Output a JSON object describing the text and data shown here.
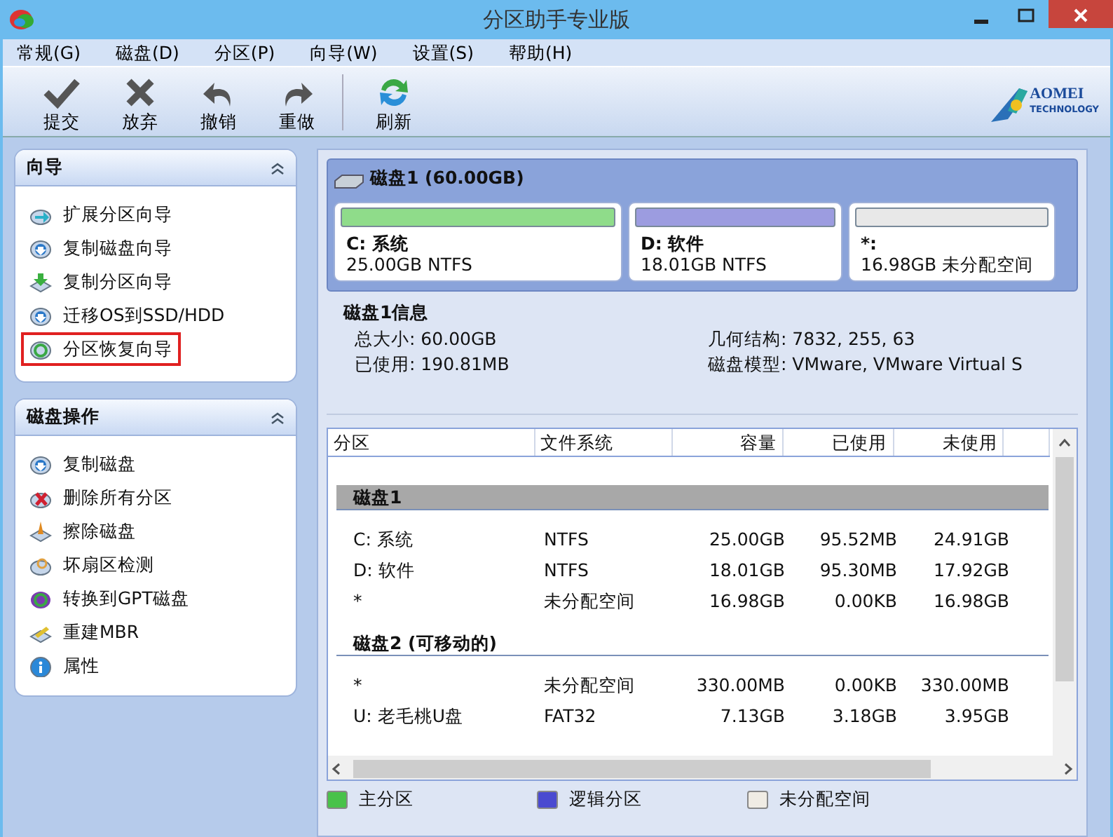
{
  "window": {
    "title": "分区助手专业版"
  },
  "menu": [
    "常规(G)",
    "磁盘(D)",
    "分区(P)",
    "向导(W)",
    "设置(S)",
    "帮助(H)"
  ],
  "toolbar": [
    {
      "label": "提交",
      "kind": "check"
    },
    {
      "label": "放弃",
      "kind": "cross"
    },
    {
      "label": "撤销",
      "kind": "undo"
    },
    {
      "label": "重做",
      "kind": "redo"
    },
    {
      "label": "刷新",
      "kind": "refresh"
    }
  ],
  "logo": {
    "name": "AOMEI",
    "tagline": "TECHNOLOGY"
  },
  "sidebar": [
    {
      "title": "向导",
      "items": [
        {
          "label": "扩展分区向导",
          "kind": "arrow",
          "highlighted": false
        },
        {
          "label": "复制磁盘向导",
          "kind": "down",
          "highlighted": false
        },
        {
          "label": "复制分区向导",
          "kind": "green",
          "highlighted": false
        },
        {
          "label": "迁移OS到SSD/HDD",
          "kind": "down",
          "highlighted": false
        },
        {
          "label": "分区恢复向导",
          "kind": "refresh",
          "highlighted": true
        }
      ]
    },
    {
      "title": "磁盘操作",
      "items": [
        {
          "label": "复制磁盘",
          "kind": "down",
          "highlighted": false
        },
        {
          "label": "删除所有分区",
          "kind": "delete",
          "highlighted": false
        },
        {
          "label": "擦除磁盘",
          "kind": "wipe",
          "highlighted": false
        },
        {
          "label": "坏扇区检测",
          "kind": "scan",
          "highlighted": false
        },
        {
          "label": "转换到GPT磁盘",
          "kind": "convert",
          "highlighted": false
        },
        {
          "label": "重建MBR",
          "kind": "mbr",
          "highlighted": false
        },
        {
          "label": "属性",
          "kind": "info",
          "highlighted": false
        }
      ]
    }
  ],
  "disk_map": {
    "title": "磁盘1 (60.00GB)",
    "partitions": [
      {
        "name": "C: 系统",
        "detail": "25.00GB NTFS",
        "color": "#8fdc8a"
      },
      {
        "name": "D: 软件",
        "detail": "18.01GB NTFS",
        "color": "#9c9ce0"
      },
      {
        "name": "*:",
        "detail": "16.98GB 未分配空间",
        "color": "#e8e8e8"
      }
    ]
  },
  "disk_info": {
    "title": "磁盘1信息",
    "fields": [
      "总大小: 60.00GB",
      "几何结构: 7832, 255, 63",
      "已使用: 190.81MB",
      "磁盘模型: VMware, VMware Virtual S"
    ]
  },
  "table": {
    "columns": [
      "分区",
      "文件系统",
      "容量",
      "已使用",
      "未使用"
    ],
    "groups": [
      {
        "title": "磁盘1",
        "selected": true,
        "rows": [
          [
            "C: 系统",
            "NTFS",
            "25.00GB",
            "95.52MB",
            "24.91GB"
          ],
          [
            "D: 软件",
            "NTFS",
            "18.01GB",
            "95.30MB",
            "17.92GB"
          ],
          [
            "*",
            "未分配空间",
            "16.98GB",
            "0.00KB",
            "16.98GB"
          ]
        ]
      },
      {
        "title": "磁盘2 (可移动的)",
        "selected": false,
        "rows": [
          [
            "*",
            "未分配空间",
            "330.00MB",
            "0.00KB",
            "330.00MB"
          ],
          [
            "U: 老毛桃U盘",
            "FAT32",
            "7.13GB",
            "3.18GB",
            "3.95GB"
          ]
        ]
      }
    ]
  },
  "legend": [
    {
      "label": "主分区",
      "color": "#49c24a"
    },
    {
      "label": "逻辑分区",
      "color": "#4a4ad0"
    },
    {
      "label": "未分配空间",
      "color": "#f0ece4"
    }
  ]
}
